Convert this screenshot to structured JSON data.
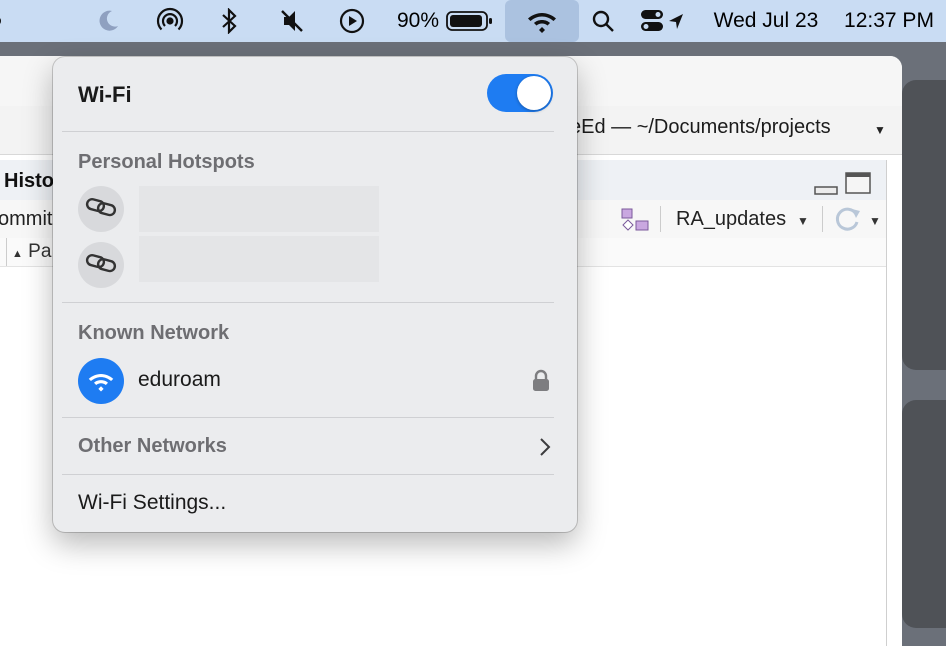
{
  "menubar": {
    "battery_percent": "90%",
    "date": "Wed Jul 23",
    "time": "12:37 PM"
  },
  "app": {
    "project_path": "ceEd — ~/Documents/projects",
    "pane_tab": "Histo",
    "commit_label": "ommit",
    "branch": "RA_updates",
    "path_column": "Pa"
  },
  "wifi_menu": {
    "title": "Wi-Fi",
    "toggle_on": true,
    "accent_color": "#1e7cf2",
    "personal_hotspots_label": "Personal Hotspots",
    "known_network_label": "Known Network",
    "known_networks": [
      {
        "name": "eduroam",
        "secured": true,
        "icon": "wifi-icon"
      }
    ],
    "other_networks_label": "Other Networks",
    "settings_label": "Wi-Fi Settings..."
  }
}
